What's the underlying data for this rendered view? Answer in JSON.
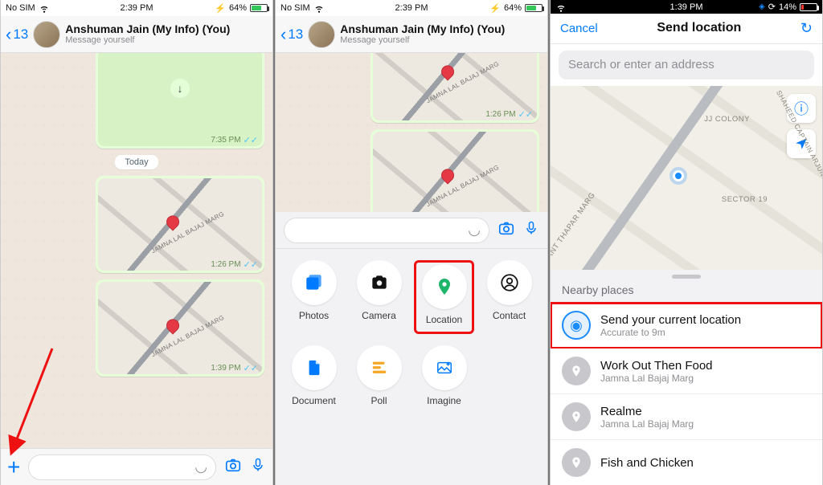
{
  "statusbar": {
    "carrier": "No SIM",
    "time1": "2:39 PM",
    "time2": "2:39 PM",
    "time3": "1:39 PM",
    "battery12": "64%",
    "battery3": "14%"
  },
  "chat": {
    "back_count": "13",
    "title": "Anshuman Jain (My Info) (You)",
    "subtitle": "Message yourself",
    "date_sep": "Today",
    "road_label": "JAMNA LAL BAJAJ MARG",
    "msg_times": {
      "a": "7:35 PM",
      "b": "1:26 PM",
      "c": "1:39 PM"
    }
  },
  "attach": {
    "items": [
      {
        "label": "Photos",
        "color": "#007aff"
      },
      {
        "label": "Camera",
        "color": "#111"
      },
      {
        "label": "Location",
        "color": "#1eb46a"
      },
      {
        "label": "Contact",
        "color": "#111"
      },
      {
        "label": "Document",
        "color": "#007aff"
      },
      {
        "label": "Poll",
        "color": "#f5a623"
      },
      {
        "label": "Imagine",
        "color": "#007aff"
      }
    ]
  },
  "location_screen": {
    "cancel": "Cancel",
    "title": "Send location",
    "search_placeholder": "Search or enter an address",
    "nearby_title": "Nearby places",
    "sector_label": "SECTOR 19",
    "jj_label": "JJ COLONY",
    "thapar_label": "ANT THAPAR MARG",
    "shaheed_label": "SHAHEED CAPTAIN ARJUN",
    "places": [
      {
        "title": "Send your current location",
        "sub": "Accurate to 9m"
      },
      {
        "title": "Work Out Then Food",
        "sub": "Jamna Lal Bajaj Marg"
      },
      {
        "title": "Realme",
        "sub": "Jamna Lal Bajaj Marg"
      },
      {
        "title": "Fish and Chicken",
        "sub": ""
      }
    ]
  },
  "icons": {
    "battery_ind": "⚡",
    "location_arrow": "➤"
  }
}
